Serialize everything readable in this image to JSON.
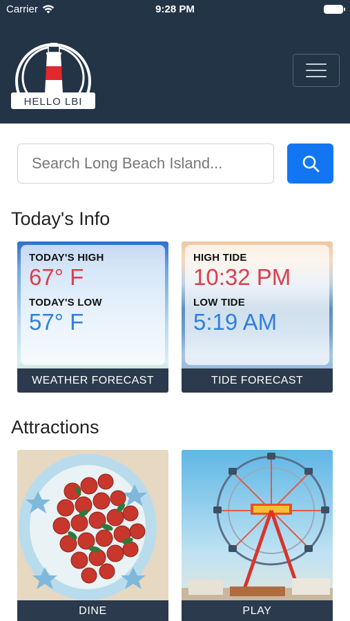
{
  "status_bar": {
    "carrier": "Carrier",
    "time": "9:28 PM"
  },
  "header": {
    "logo_text": "HELLO LBI",
    "menu_icon": "hamburger-menu-icon"
  },
  "search": {
    "placeholder": "Search Long Beach Island...",
    "button_icon": "search-icon"
  },
  "todays_info": {
    "title": "Today's Info",
    "weather": {
      "high_label": "TODAY'S HIGH",
      "high_value": "67° F",
      "low_label": "TODAY'S LOW",
      "low_value": "57° F",
      "footer": "WEATHER FORECAST"
    },
    "tide": {
      "high_label": "HIGH TIDE",
      "high_value": "10:32 PM",
      "low_label": "LOW TIDE",
      "low_value": "5:19 AM",
      "footer": "TIDE FORECAST"
    }
  },
  "attractions": {
    "title": "Attractions",
    "items": [
      {
        "label": "DINE"
      },
      {
        "label": "PLAY"
      }
    ]
  },
  "colors": {
    "header_bg": "#243447",
    "accent_blue": "#1276f3",
    "high_red": "#dd3d4a",
    "low_blue": "#2f7fe0"
  }
}
